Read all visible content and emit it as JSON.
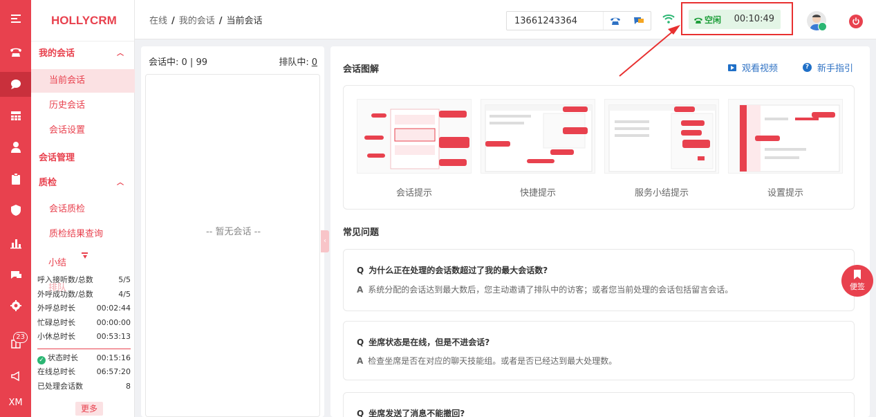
{
  "brand": "HOLLYCRM",
  "rail": {
    "items": [
      "phone-icon",
      "chat-icon",
      "grid-icon",
      "user-icon",
      "clipboard-icon",
      "shield-icon",
      "bar-chart-icon",
      "message-icon",
      "gear-icon",
      "export-icon",
      "announce-icon"
    ],
    "badge": "23",
    "footer": "XM"
  },
  "submenu": {
    "group_my_sessions": "我的会话",
    "current_session": "当前会话",
    "history_session": "历史会话",
    "session_settings": "会话设置",
    "group_session_manage": "会话管理",
    "group_quality": "质检",
    "session_quality": "会话质检",
    "quality_result": "质检结果查询"
  },
  "stats": {
    "tab_summary": "小结",
    "tab_queue": "排队",
    "rows": [
      {
        "label": "呼入接听数/总数",
        "value": "5/5"
      },
      {
        "label": "外呼成功数/总数",
        "value": "4/5"
      },
      {
        "label": "外呼总时长",
        "value": "00:02:44"
      },
      {
        "label": "忙碌总时长",
        "value": "00:00:00"
      },
      {
        "label": "小休总时长",
        "value": "00:53:13"
      }
    ],
    "rows2": [
      {
        "label": "状态时长",
        "value": "00:15:16"
      },
      {
        "label": "在线总时长",
        "value": "06:57:20"
      },
      {
        "label": "已处理会话数",
        "value": "8"
      }
    ],
    "more": "更多"
  },
  "header": {
    "crumbs": [
      "在线",
      "我的会话",
      "当前会话"
    ],
    "sep": "/",
    "phone": "13661243364",
    "status_label": "空闲",
    "status_time": "00:10:49"
  },
  "list": {
    "in_session_label": "会话中:",
    "in_session_value": "0 | 99",
    "queue_label": "排队中:",
    "queue_value": "0",
    "empty": "-- 暂无会话 --"
  },
  "main": {
    "diagram_title": "会话图解",
    "watch_video": "观看视频",
    "guide": "新手指引",
    "thumbs": [
      "会话提示",
      "快捷提示",
      "服务小结提示",
      "设置提示"
    ],
    "faq_title": "常见问题",
    "faqs": [
      {
        "q": "为什么正在处理的会话数超过了我的最大会话数?",
        "a": "系统分配的会话达到最大数后，您主动邀请了排队中的访客；或者您当前处理的会话包括留言会话。"
      },
      {
        "q": "坐席状态是在线，但是不进会话?",
        "a": "检查坐席是否在对应的聊天技能组。或者是否已经达到最大处理数。"
      },
      {
        "q": "坐席发送了消息不能撤回?",
        "a": ""
      }
    ],
    "q_mark": "Q",
    "a_mark": "A"
  },
  "note": "便签",
  "colors": {
    "brand": "#e8414e",
    "status_green": "#1e9e3a",
    "link": "#2f72c4"
  }
}
